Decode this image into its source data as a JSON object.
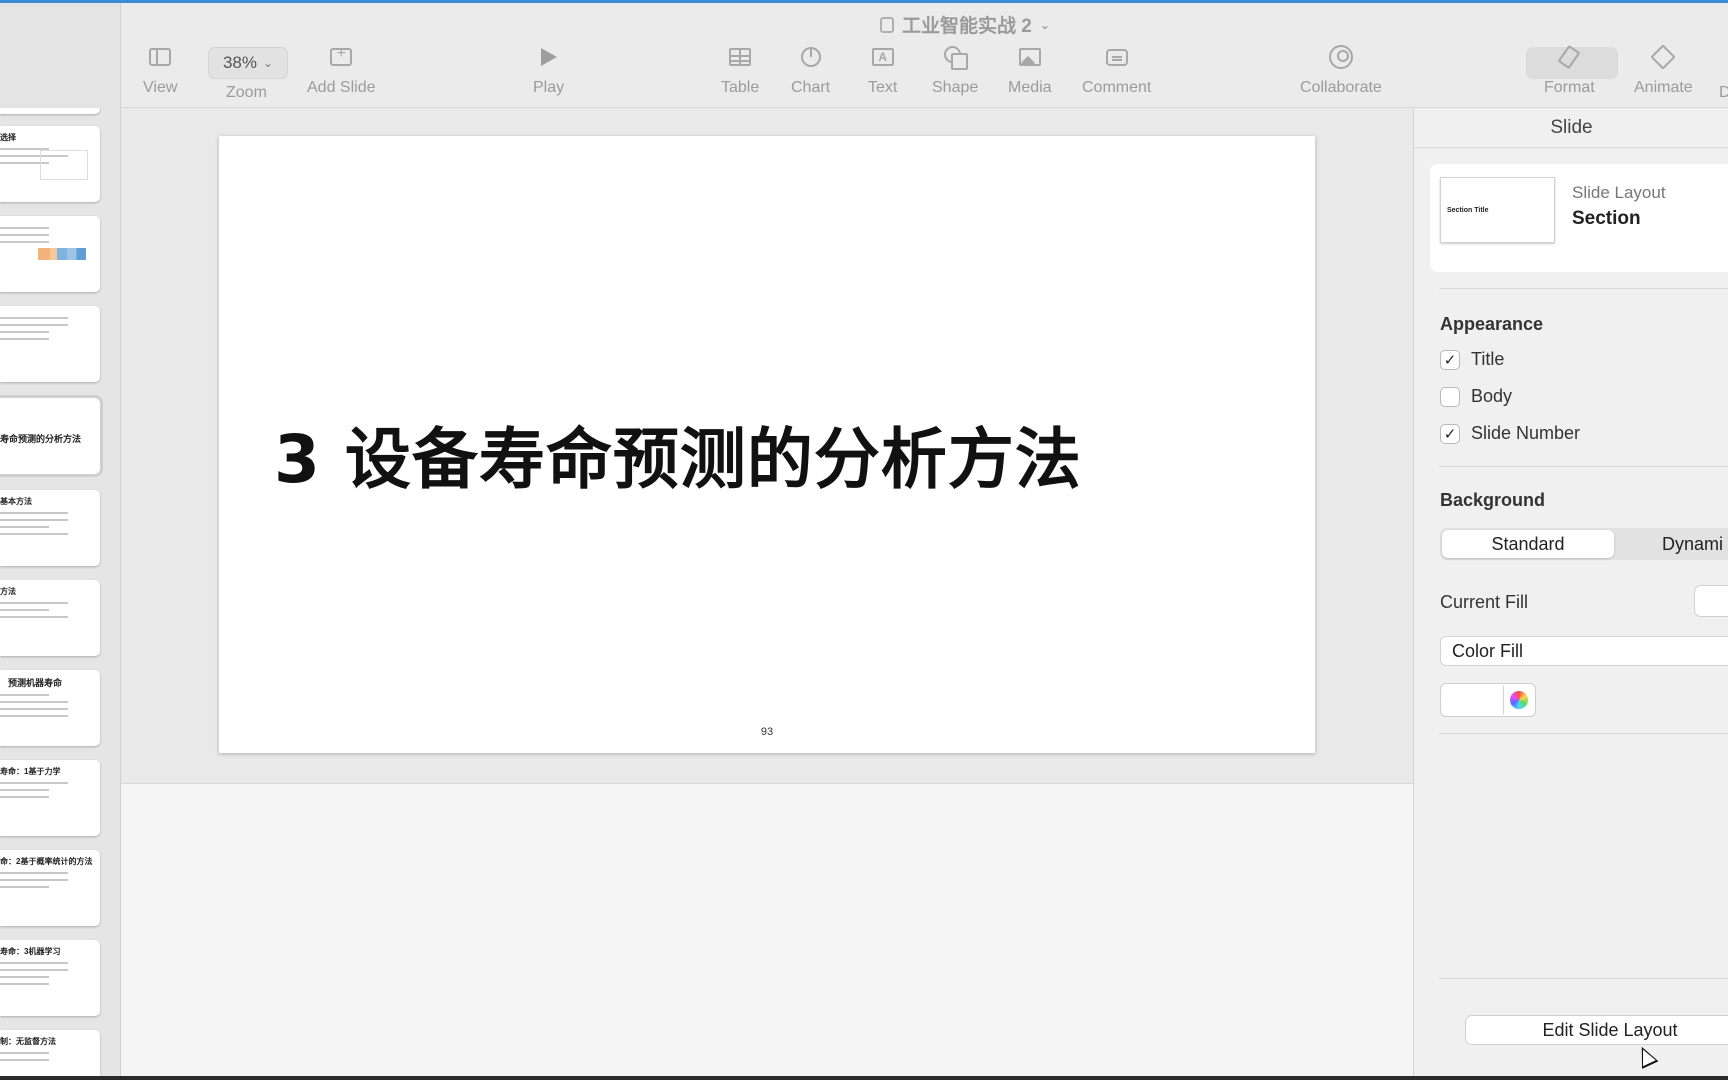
{
  "window": {
    "document_title": "工业智能实战 2"
  },
  "toolbar": {
    "view_label": "View",
    "zoom_value": "38%",
    "zoom_label": "Zoom",
    "add_slide_label": "Add Slide",
    "play_label": "Play",
    "table_label": "Table",
    "chart_label": "Chart",
    "text_label": "Text",
    "shape_label": "Shape",
    "media_label": "Media",
    "comment_label": "Comment",
    "collaborate_label": "Collaborate",
    "format_label": "Format",
    "animate_label": "Animate",
    "document_label": "D"
  },
  "navigator": {
    "thumbs": [
      {
        "title": "选择"
      },
      {
        "title": ""
      },
      {
        "title": ""
      },
      {
        "title": "寿命预测的分析方法",
        "selected": true
      },
      {
        "title": "基本方法"
      },
      {
        "title": "方法"
      },
      {
        "title": "预测机器寿命"
      },
      {
        "title": "寿命：1基于力学"
      },
      {
        "title": "命：2基于概率统计的方法"
      },
      {
        "title": "寿命：3机器学习"
      },
      {
        "title": "制：无监督方法"
      }
    ]
  },
  "slide": {
    "title": "3 设备寿命预测的分析方法",
    "number": "93"
  },
  "inspector": {
    "header": "Slide",
    "layout_thumb_text": "Section Title",
    "layout_label": "Slide Layout",
    "layout_value": "Section",
    "appearance_heading": "Appearance",
    "appearance": {
      "title": {
        "label": "Title",
        "checked": true
      },
      "body": {
        "label": "Body",
        "checked": false
      },
      "slide_number": {
        "label": "Slide Number",
        "checked": true
      }
    },
    "background_heading": "Background",
    "background_tabs": {
      "standard": "Standard",
      "dynamic": "Dynami"
    },
    "current_fill_label": "Current Fill",
    "fill_type": "Color Fill",
    "edit_layout_label": "Edit Slide Layout"
  },
  "colors": {
    "accent": "#3d8bd6",
    "toolbar_bg": "#ebebeb",
    "slide_bg": "#ffffff"
  }
}
